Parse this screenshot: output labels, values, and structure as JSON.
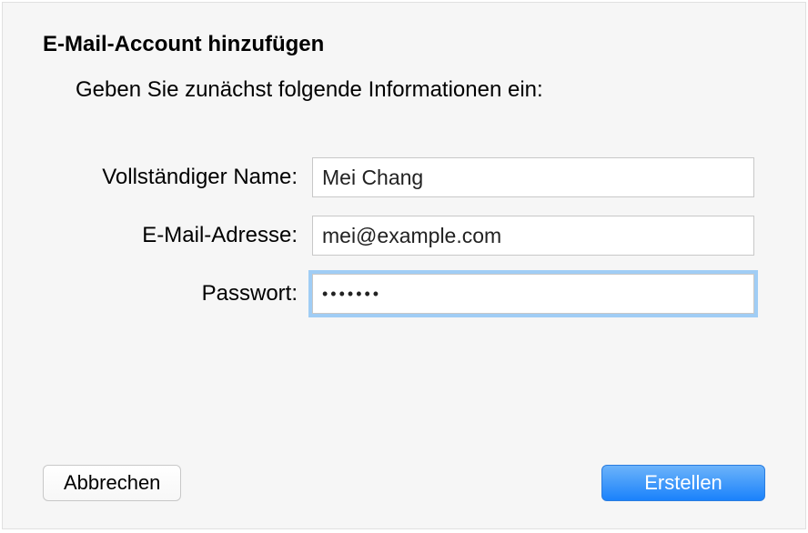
{
  "dialog": {
    "title": "E-Mail-Account hinzufügen",
    "instruction": "Geben Sie zunächst folgende Informationen ein:"
  },
  "form": {
    "fullName": {
      "label": "Vollständiger Name:",
      "value": "Mei Chang"
    },
    "email": {
      "label": "E-Mail-Adresse:",
      "value": "mei@example.com"
    },
    "password": {
      "label": "Passwort:",
      "value": "•••••••"
    }
  },
  "buttons": {
    "cancel": "Abbrechen",
    "create": "Erstellen"
  }
}
